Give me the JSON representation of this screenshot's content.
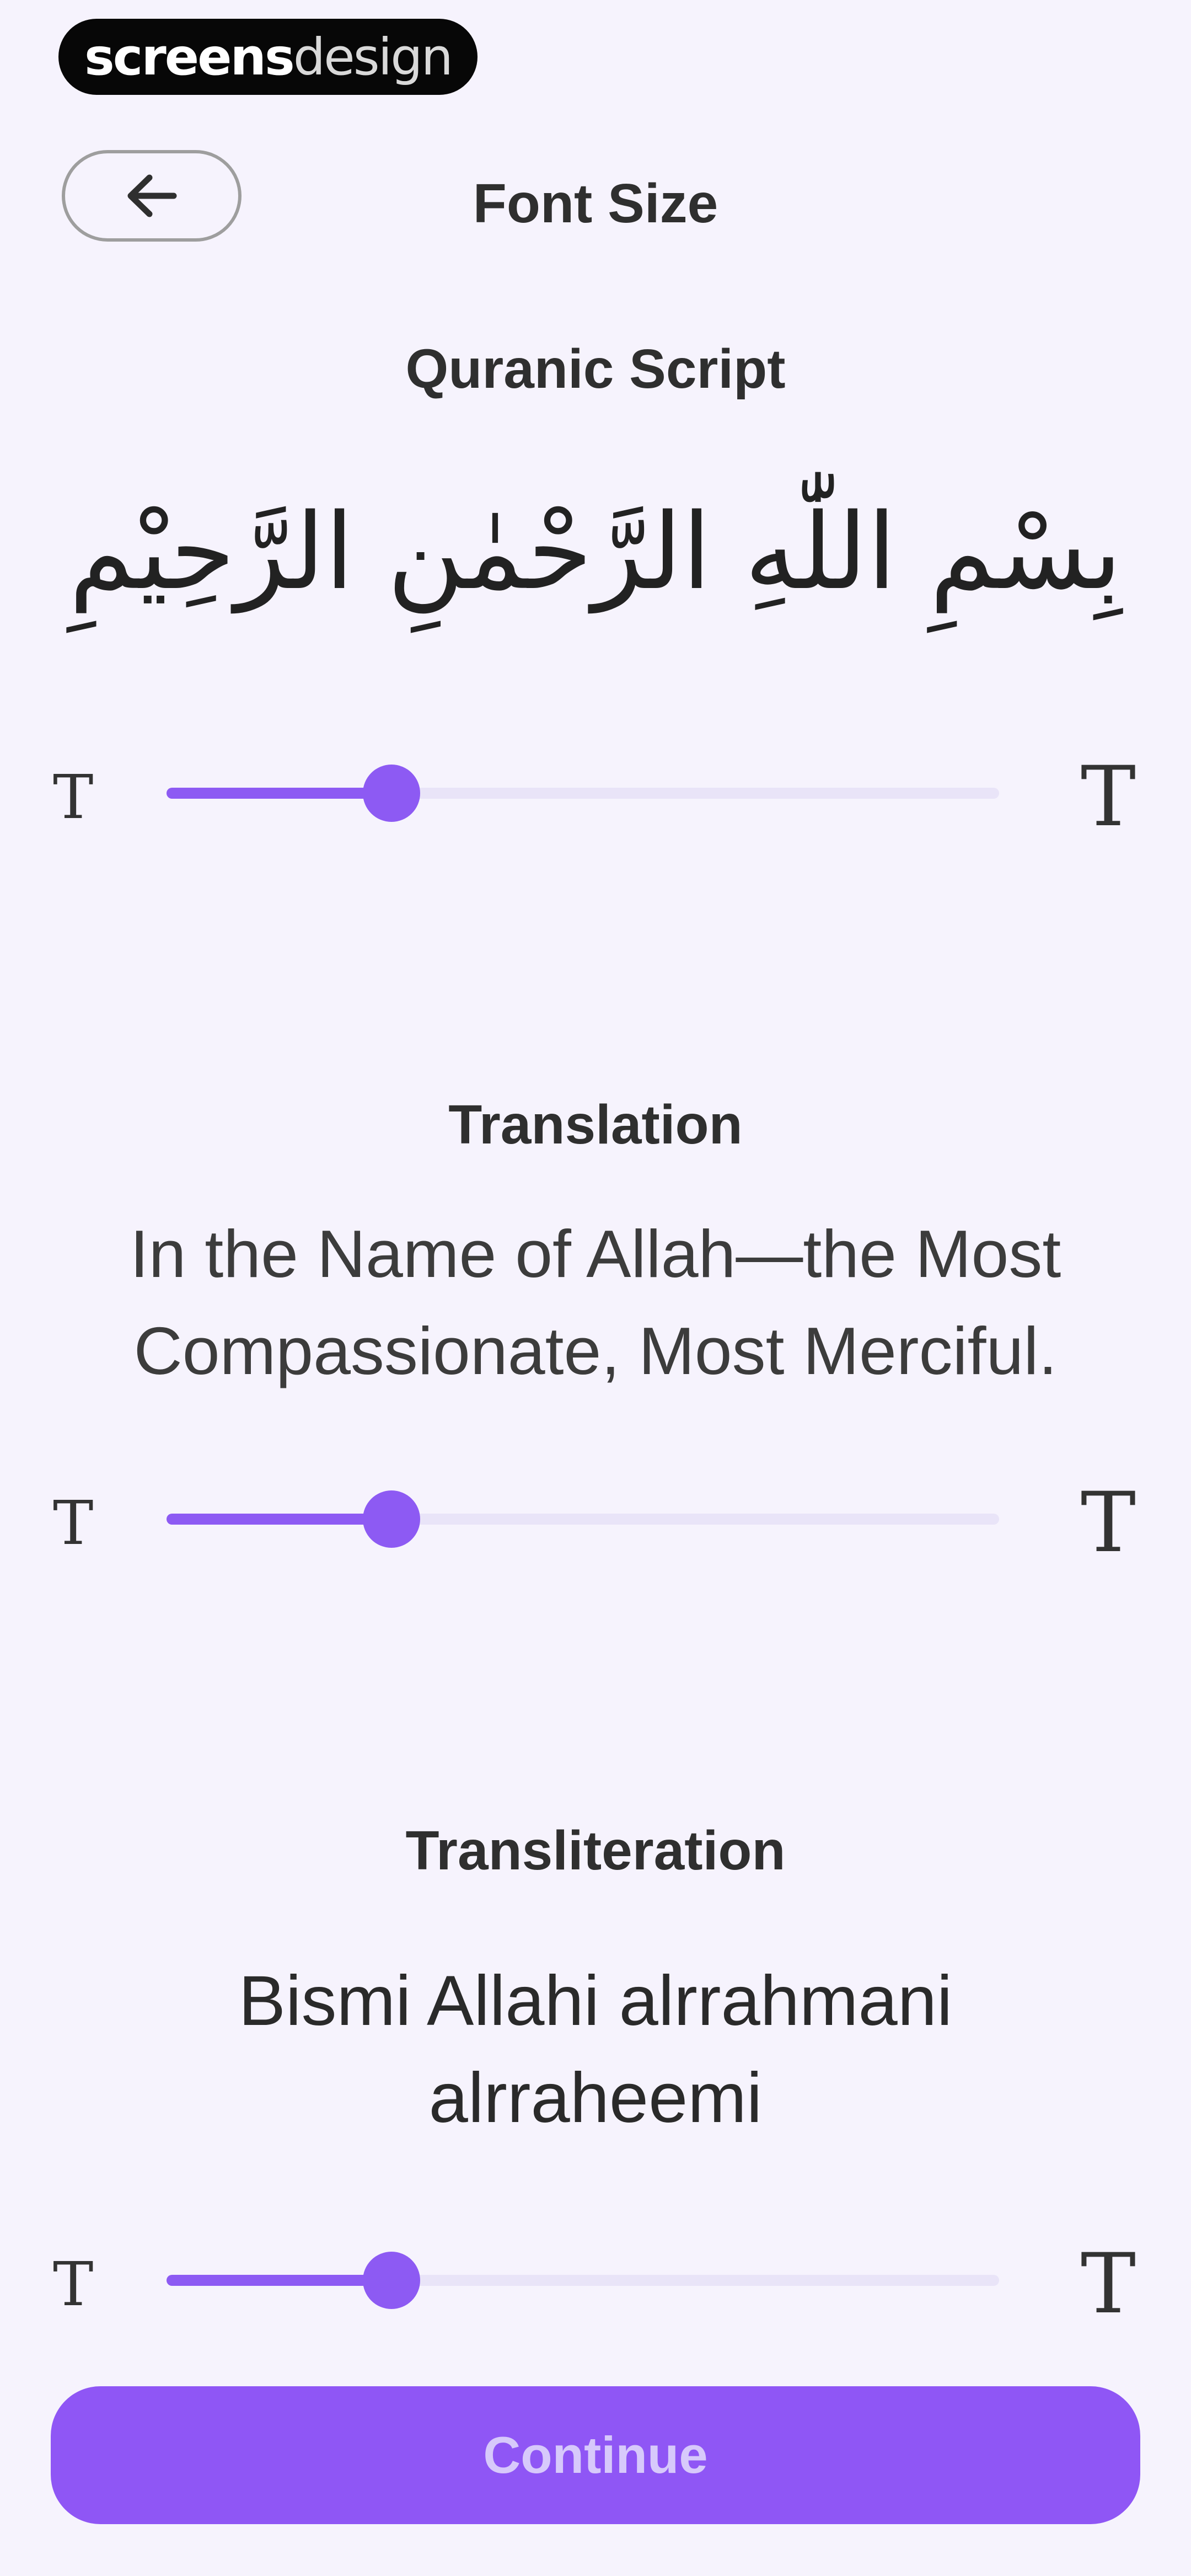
{
  "watermark": {
    "bold": "screens",
    "light": "design"
  },
  "header": {
    "title": "Font Size"
  },
  "quranic": {
    "title": "Quranic Script",
    "text": "بِسْمِ اللّٰهِ الرَّحْمٰنِ الرَّحِيْمِ",
    "slider_level": 0.27
  },
  "translation": {
    "title": "Translation",
    "line1": "In the Name of Allah—the Most",
    "line2": "Compassionate, Most Merciful.",
    "slider_level": 0.27
  },
  "transliteration": {
    "title": "Transliteration",
    "line1": "Bismi Allahi alrrahmani",
    "line2": "alrraheemi",
    "slider_level": 0.27
  },
  "slider_labels": {
    "small": "T",
    "large": "T"
  },
  "continue_label": "Continue",
  "colors": {
    "accent": "#8d5af3",
    "background": "#f6f3fd"
  }
}
